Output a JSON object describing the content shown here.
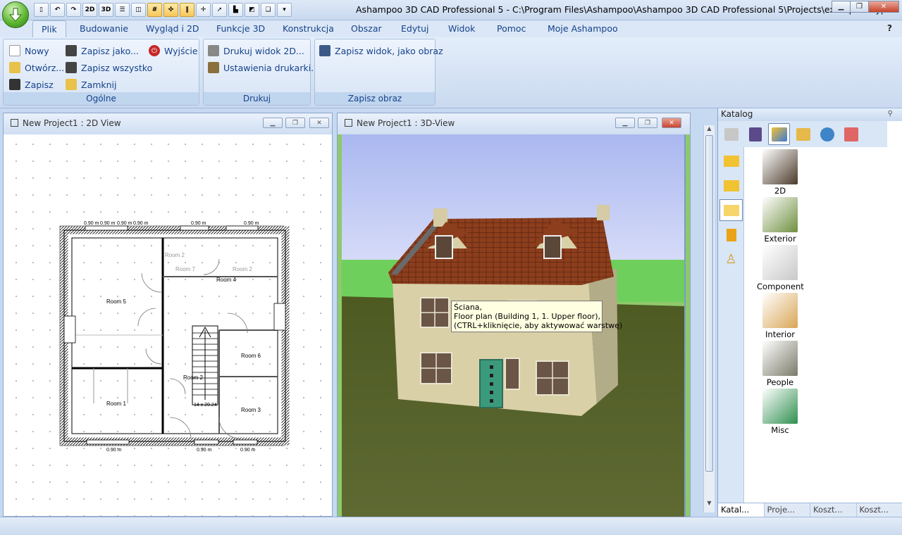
{
  "window": {
    "title": "Ashampoo 3D CAD Professional 5 - C:\\Program Files\\Ashampoo\\Ashampoo 3D CAD Professional 5\\Projects\\example4.cyp",
    "minimize": "▁",
    "maximize": "❐",
    "close": "✕"
  },
  "qat": {
    "btn_2d": "2D",
    "btn_3d": "3D"
  },
  "tabs": [
    "Plik",
    "Budowanie",
    "Wygląd i 2D",
    "Funkcje 3D",
    "Konstrukcja",
    "Obszar",
    "Edytuj",
    "Widok",
    "Pomoc",
    "Moje Ashampoo"
  ],
  "help": "?",
  "ribbon": {
    "general": {
      "label": "Ogólne",
      "new": "Nowy",
      "open": "Otwórz...",
      "save": "Zapisz",
      "save_as": "Zapisz jako...",
      "save_all": "Zapisz wszystko",
      "close": "Zamknij",
      "exit": "Wyjście"
    },
    "print": {
      "label": "Drukuj",
      "print_view": "Drukuj widok 2D...",
      "printer_settings": "Ustawienia drukarki..."
    },
    "save_image": {
      "label": "Zapisz obraz",
      "save_view": "Zapisz widok, jako obraz"
    }
  },
  "view2d": {
    "title": "New Project1 : 2D View",
    "rooms": [
      "Room 5",
      "Room 1",
      "Room 2",
      "Room 3",
      "Room 4",
      "Room 6",
      "Room 7",
      "Room 2",
      "Room 2"
    ],
    "dims_top": [
      "0.90 m",
      "0.90 m",
      "0.90 m",
      "0.90 m",
      "0.90 m",
      "0.90 m"
    ],
    "dims_bottom": [
      "0.90 m",
      "0.90 m",
      "0.90 m"
    ],
    "stairs": "14 x 20.24"
  },
  "view3d": {
    "title": "New Project1 : 3D-View",
    "tooltip": {
      "line1": "Ściana,",
      "line2": "Floor plan (Building 1, 1. Upper floor),",
      "line3": "(CTRL+kliknięcie, aby aktywować warstwę)"
    }
  },
  "catalog": {
    "title": "Katalog",
    "items": [
      {
        "label": "2D",
        "color": "#4a3a2a"
      },
      {
        "label": "Exterior",
        "color": "#6f8f3f"
      },
      {
        "label": "Component",
        "color": "#c9c9c9"
      },
      {
        "label": "Interior",
        "color": "#d9a657"
      },
      {
        "label": "People",
        "color": "#7a7a6a"
      },
      {
        "label": "Misc",
        "color": "#2f8f4f"
      }
    ],
    "tabs": [
      "Katal...",
      "Proje...",
      "Koszt...",
      "Koszt..."
    ]
  },
  "status": {
    "text": ""
  }
}
